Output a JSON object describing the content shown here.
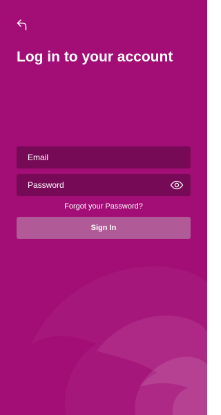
{
  "colors": {
    "background": "#a30d76",
    "field_background": "#770a57",
    "button_background": "#b05a97",
    "text": "#ffffff"
  },
  "header": {
    "back_icon": "back-arrow-icon"
  },
  "title": "Log in to your account",
  "form": {
    "email_placeholder": "Email",
    "password_placeholder": "Password",
    "password_toggle_icon": "eye-icon",
    "forgot_password": "Forgot your Password?",
    "sign_in": "Sign In"
  }
}
